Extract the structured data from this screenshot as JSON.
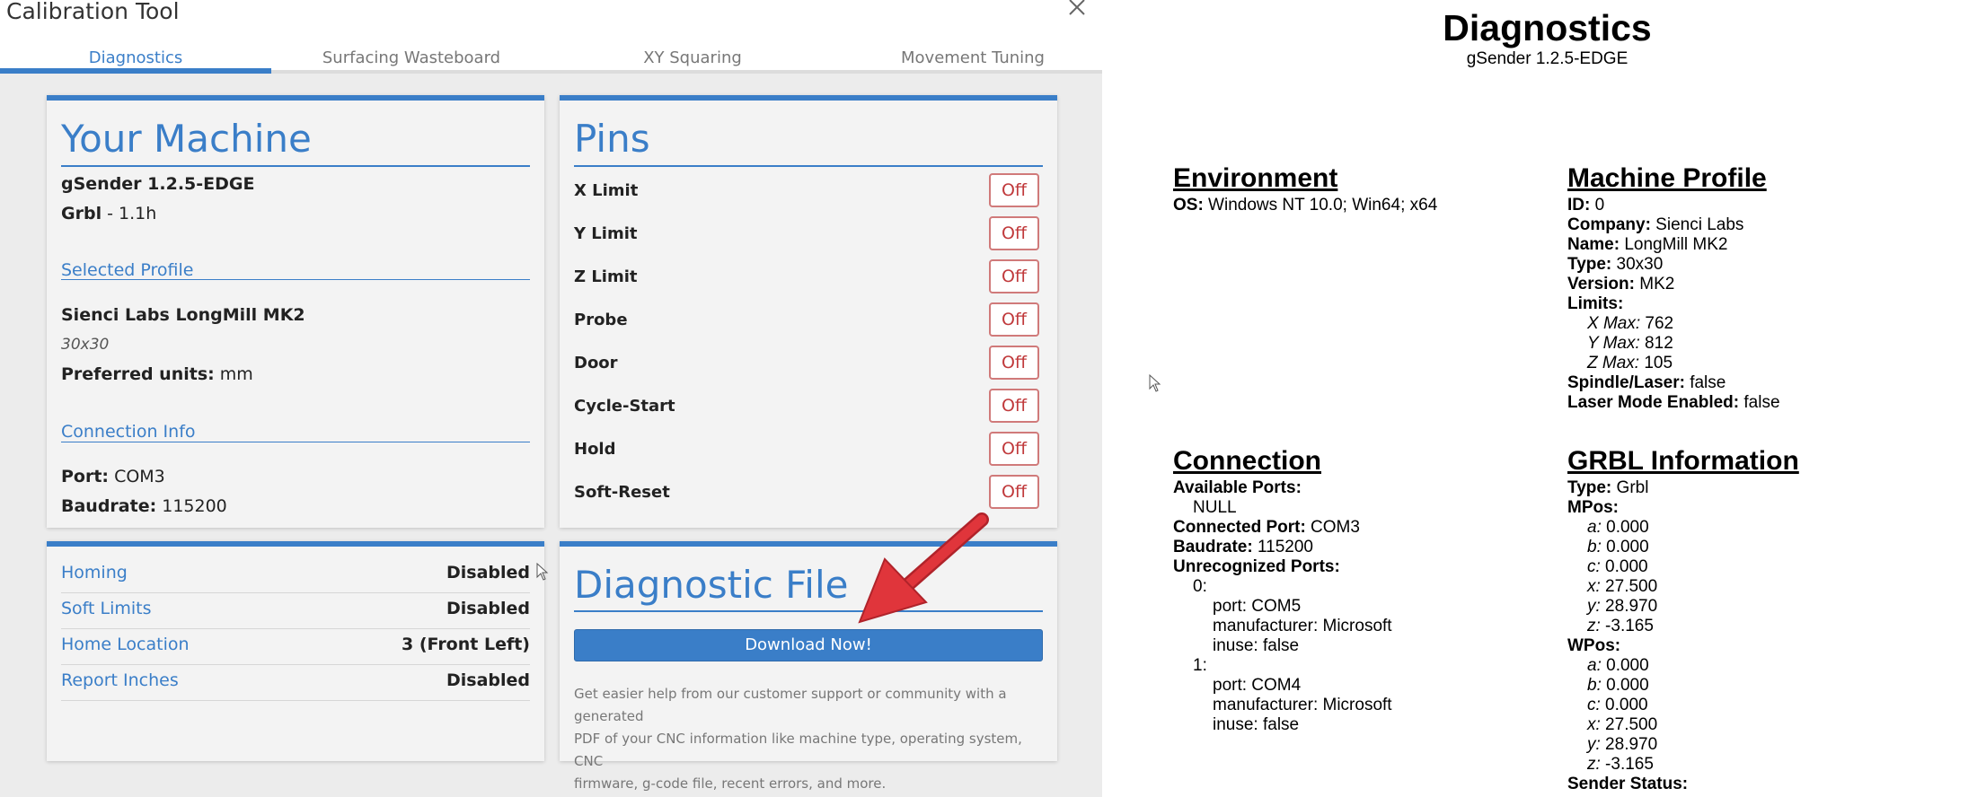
{
  "modal": {
    "title": "Calibration Tool",
    "tabs": [
      {
        "label": "Diagnostics",
        "active": true
      },
      {
        "label": "Surfacing Wasteboard",
        "active": false
      },
      {
        "label": "XY Squaring",
        "active": false
      },
      {
        "label": "Movement Tuning",
        "active": false
      }
    ]
  },
  "machine": {
    "heading": "Your Machine",
    "sender_version": "gSender 1.2.5-EDGE",
    "firmware_name": "Grbl",
    "firmware_version": " - 1.1h",
    "profile_heading": "Selected Profile",
    "profile_name": "Sienci Labs LongMill MK2",
    "profile_size": "30x30",
    "units_label": "Preferred units:",
    "units_value": " mm",
    "connection_heading": "Connection Info",
    "port_label": "Port:",
    "port_value": " COM3",
    "baud_label": "Baudrate:",
    "baud_value": " 115200"
  },
  "pins": {
    "heading": "Pins",
    "items": [
      {
        "label": "X Limit",
        "state": "Off"
      },
      {
        "label": "Y Limit",
        "state": "Off"
      },
      {
        "label": "Z Limit",
        "state": "Off"
      },
      {
        "label": "Probe",
        "state": "Off"
      },
      {
        "label": "Door",
        "state": "Off"
      },
      {
        "label": "Cycle-Start",
        "state": "Off"
      },
      {
        "label": "Hold",
        "state": "Off"
      },
      {
        "label": "Soft-Reset",
        "state": "Off"
      }
    ]
  },
  "settings": [
    {
      "label": "Homing",
      "value": "Disabled"
    },
    {
      "label": "Soft Limits",
      "value": "Disabled"
    },
    {
      "label": "Home Location",
      "value": "3 (Front Left)"
    },
    {
      "label": "Report Inches",
      "value": "Disabled"
    }
  ],
  "diagnostic_file": {
    "heading": "Diagnostic File",
    "button": "Download Now!",
    "help_lines": [
      "Get easier help from our customer support or community with a generated",
      "PDF of your CNC information like machine type, operating system, CNC",
      "firmware, g-code file, recent errors, and more."
    ]
  },
  "report": {
    "title": "Diagnostics",
    "subtitle": "gSender 1.2.5-EDGE",
    "environment": {
      "heading": "Environment",
      "os_label": "OS:",
      "os_value": " Windows NT 10.0; Win64; x64"
    },
    "machine_profile": {
      "heading": "Machine Profile",
      "id_label": "ID:",
      "id_value": " 0",
      "company_label": "Company:",
      "company_value": " Sienci Labs",
      "name_label": "Name:",
      "name_value": " LongMill MK2",
      "type_label": "Type:",
      "type_value": " 30x30",
      "version_label": "Version:",
      "version_value": " MK2",
      "limits_label": "Limits:",
      "xmax_label": "X Max:",
      "xmax_value": " 762",
      "ymax_label": "Y Max:",
      "ymax_value": " 812",
      "zmax_label": "Z Max:",
      "zmax_value": " 105",
      "spindle_label": "Spindle/Laser:",
      "spindle_value": " false",
      "laser_label": "Laser Mode Enabled:",
      "laser_value": " false"
    },
    "connection": {
      "heading": "Connection",
      "available_label": "Available Ports:",
      "available_value": "NULL",
      "connected_label": "Connected Port:",
      "connected_value": " COM3",
      "baud_label": "Baudrate:",
      "baud_value": " 115200",
      "unrecognized_label": "Unrecognized Ports:",
      "idx0": "0:",
      "p0_port": "port: COM5",
      "p0_manufacturer": "manufacturer: Microsoft",
      "p0_inuse": "inuse: false",
      "idx1": "1:",
      "p1_port": "port: COM4",
      "p1_manufacturer": "manufacturer: Microsoft",
      "p1_inuse": "inuse: false"
    },
    "grbl": {
      "heading": "GRBL Information",
      "type_label": "Type:",
      "type_value": " Grbl",
      "mpos_label": "MPos:",
      "mpos": [
        {
          "k": "a:",
          "v": " 0.000"
        },
        {
          "k": "b:",
          "v": " 0.000"
        },
        {
          "k": "c:",
          "v": " 0.000"
        },
        {
          "k": "x:",
          "v": " 27.500"
        },
        {
          "k": "y:",
          "v": " 28.970"
        },
        {
          "k": "z:",
          "v": " -3.165"
        }
      ],
      "wpos_label": "WPos:",
      "wpos": [
        {
          "k": "a:",
          "v": " 0.000"
        },
        {
          "k": "b:",
          "v": " 0.000"
        },
        {
          "k": "c:",
          "v": " 0.000"
        },
        {
          "k": "x:",
          "v": " 27.500"
        },
        {
          "k": "y:",
          "v": " 28.970"
        },
        {
          "k": "z:",
          "v": " -3.165"
        }
      ],
      "sender_status_label": "Sender Status:"
    }
  }
}
